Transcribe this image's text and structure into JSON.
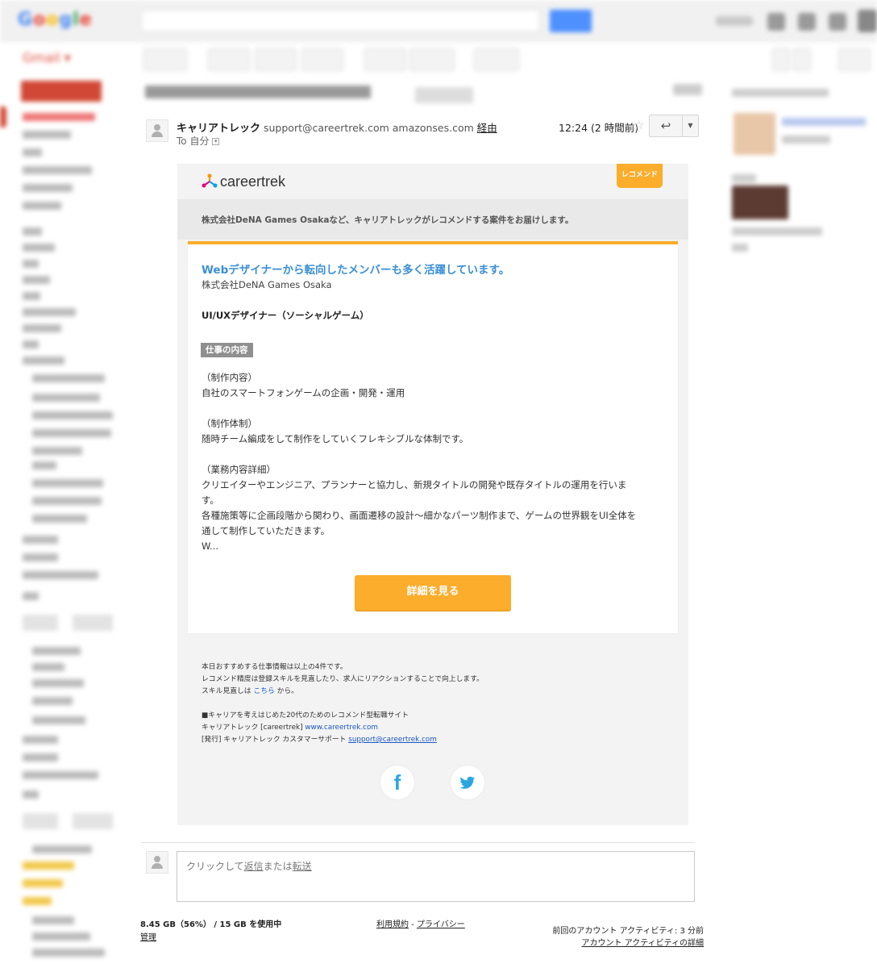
{
  "email": {
    "sender_name": "キャリアトレック",
    "sender_email": "support@careertrek.com",
    "via_domain": "amazonses.com",
    "via_label": "経由",
    "to_label": "To 自分",
    "time": "12:24 (2 時間前)"
  },
  "body": {
    "logo_text": "careertrek",
    "reco_badge": "レコメンド",
    "intro": "株式会社DeNA Games Osakaなど、キャリアトレックがレコメンドする案件をお届けします。",
    "job": {
      "headline": "Webデザイナーから転向したメンバーも多く活躍しています。",
      "company": "株式会社DeNA Games Osaka",
      "title": "UI/UXデザイナー（ソーシャルゲーム）",
      "tag": "仕事の内容",
      "description": "（制作内容）\n自社のスマートフォンゲームの企画・開発・運用\n\n（制作体制）\n随時チーム編成をして制作をしていくフレキシブルな体制です。\n\n（業務内容詳細）\nクリエイターやエンジニア、プランナーと協力し、新規タイトルの開発や既存タイトルの運用を行いま\nす。\n各種施策等に企画段階から関わり、画面遷移の設計〜細かなパーツ制作まで、ゲームの世界観をUI全体を\n通して制作していただきます。\nW...",
      "button": "詳細を見る"
    },
    "footer": {
      "line1": "本日おすすめする仕事情報は以上の4件です。",
      "line2": "レコメンド精度は登録スキルを見直したり、求人にリアクションすることで向上します。",
      "line3_pre": "スキル見直しは",
      "line3_link": "こちら",
      "line3_post": "から。",
      "line4": "■キャリアを考えはじめた20代のためのレコメンド型転職サイト",
      "line5_pre": "キャリアトレック [careertrek]",
      "line5_link": "www.careertrek.com",
      "line6_pre": "[発行] キャリアトレック カスタマーサポート",
      "line6_link": "support@careertrek.com"
    }
  },
  "reply": {
    "prefix": "クリックして",
    "reply_word": "返信",
    "middle": "または",
    "forward_word": "転送"
  },
  "page_footer": {
    "storage": "8.45 GB（56%） / 15 GB を使用中",
    "manage": "管理",
    "terms": "利用規約",
    "sep": " - ",
    "privacy": "プライバシー",
    "activity_line1": "前回のアカウント アクティビティ: 3 分前",
    "activity_line2": "アカウント アクティビティの詳細"
  },
  "icons": {
    "reply": "reply-arrow-icon",
    "star": "star-icon",
    "facebook": "facebook-icon",
    "twitter": "twitter-icon"
  },
  "colors": {
    "accent_orange": "#fbad2b",
    "headline_blue": "#3a8fd6",
    "link_blue": "#1a57c4"
  }
}
